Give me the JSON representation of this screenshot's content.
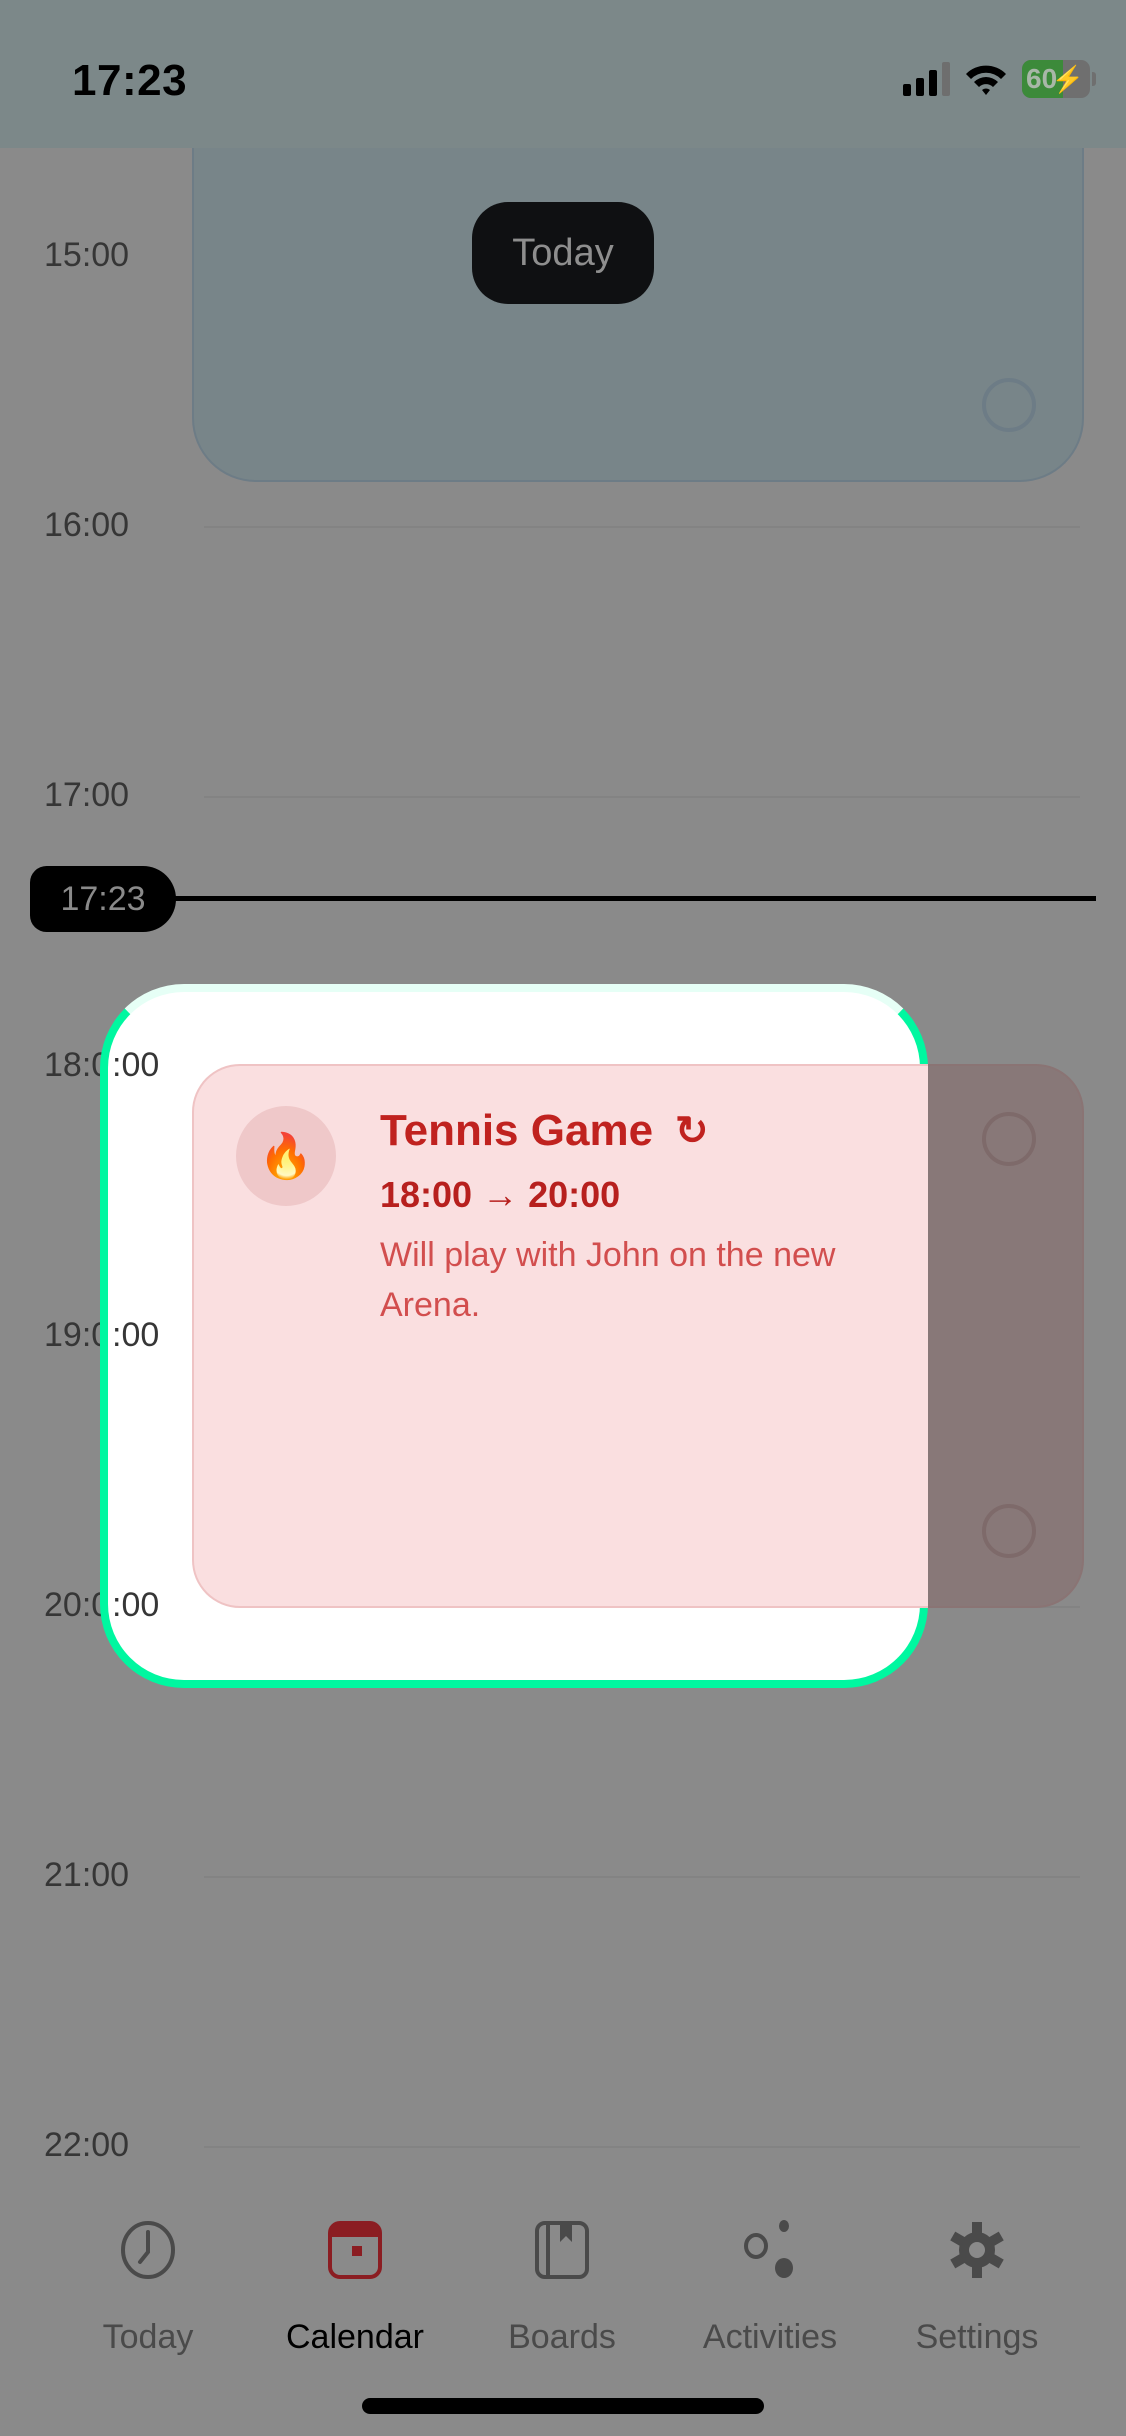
{
  "status_bar": {
    "time": "17:23",
    "battery": "60"
  },
  "calendar": {
    "hours": [
      "15:00",
      "16:00",
      "17:00",
      "18:00",
      "19:00",
      "20:00",
      "21:00",
      "22:00"
    ],
    "today_button": "Today",
    "now_time": "17:23"
  },
  "event": {
    "emoji": "🔥",
    "title": "Tennis Game",
    "repeat_icon": "↻",
    "time_range": "18:00 → 20:00",
    "description": "Will play with John on the new Arena.",
    "colors": {
      "title": "#c0221f",
      "background": "#fadfe0",
      "drag_outline": "#00f7a0"
    }
  },
  "drag_hour_fragments": {
    "h18": ":00",
    "h19": ":00",
    "h20": ":00"
  },
  "tabs": [
    {
      "label": "Today",
      "icon": "clock-icon"
    },
    {
      "label": "Calendar",
      "icon": "calendar-icon",
      "active": true
    },
    {
      "label": "Boards",
      "icon": "book-icon"
    },
    {
      "label": "Activities",
      "icon": "activities-icon"
    },
    {
      "label": "Settings",
      "icon": "gear-icon"
    }
  ],
  "accent_color": "#8b1d22"
}
